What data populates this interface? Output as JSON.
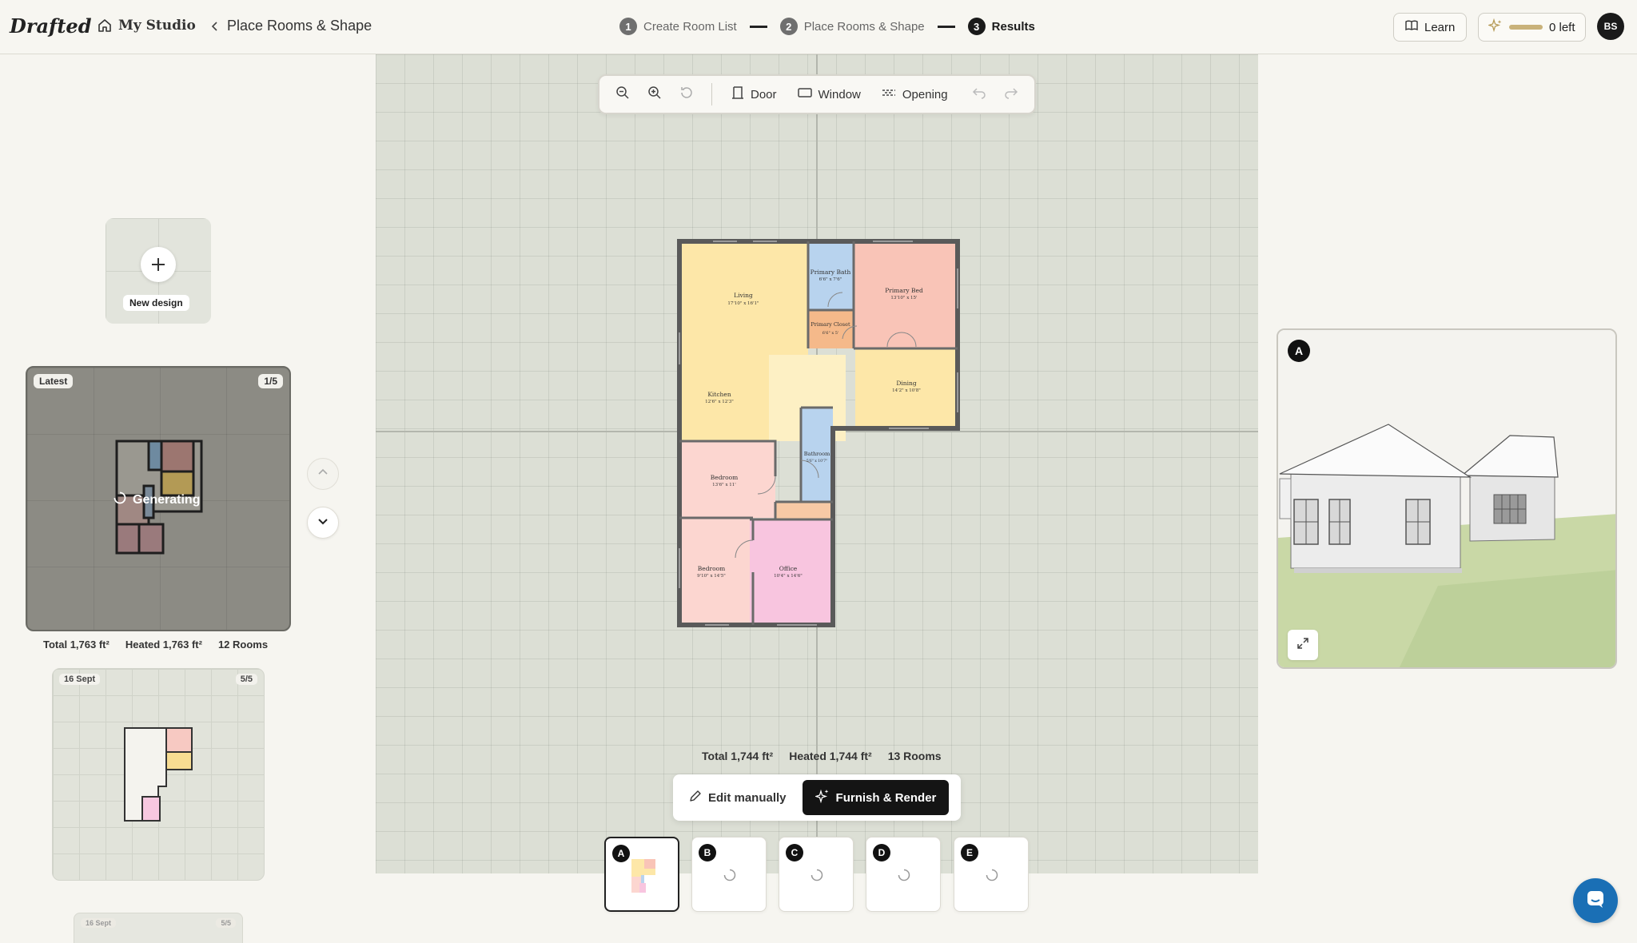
{
  "app": {
    "logo": "Drafted"
  },
  "breadcrumb": {
    "studio": "My Studio",
    "current": "Place Rooms & Shape"
  },
  "steps": [
    {
      "num": "1",
      "label": "Create Room List"
    },
    {
      "num": "2",
      "label": "Place Rooms & Shape"
    },
    {
      "num": "3",
      "label": "Results"
    }
  ],
  "header": {
    "learn_label": "Learn",
    "credits_label": "0 left",
    "avatar_initials": "BS"
  },
  "sidebar": {
    "new_design_label": "New design",
    "latest": {
      "tag": "Latest",
      "count": "1/5",
      "status": "Generating",
      "stats": {
        "total": "Total 1,763 ft²",
        "heated": "Heated 1,763 ft²",
        "rooms": "12 Rooms"
      }
    },
    "history": [
      {
        "date": "16 Sept",
        "count": "5/5"
      },
      {
        "date": "16 Sept",
        "count": "5/5"
      }
    ]
  },
  "toolbar": {
    "door": "Door",
    "window": "Window",
    "opening": "Opening"
  },
  "plan": {
    "rooms": [
      {
        "name": "Living",
        "dims": "17'10\" x 16'1\""
      },
      {
        "name": "Primary Bath",
        "dims": "6'6\" x 7'6\""
      },
      {
        "name": "Primary Bed",
        "dims": "13'10\" x 15'"
      },
      {
        "name": "Primary Closet",
        "dims": "6'6\" x 5'"
      },
      {
        "name": "Kitchen",
        "dims": "12'6\" x 12'3\""
      },
      {
        "name": "Dining",
        "dims": "14'2\" x 10'8\""
      },
      {
        "name": "Bathroom",
        "dims": "5'6\" x 10'7\""
      },
      {
        "name": "Bedroom",
        "dims": "13'6\" x 11'"
      },
      {
        "name": "Bedroom",
        "dims": "9'10\" x 14'5\""
      },
      {
        "name": "Office",
        "dims": "10'4\" x 14'6\""
      }
    ],
    "stats": {
      "total": "Total 1,744 ft²",
      "heated": "Heated 1,744 ft²",
      "rooms": "13 Rooms"
    }
  },
  "actions": {
    "edit": "Edit manually",
    "furnish": "Furnish & Render"
  },
  "variants": [
    "A",
    "B",
    "C",
    "D",
    "E"
  ],
  "render": {
    "label": "A"
  },
  "colors": {
    "accent": "#141414",
    "living": "#fde7a8",
    "bath": "#b8d3ee",
    "bedroom": "#f9c4b7",
    "office": "#f8c5df",
    "closet": "#f5b98a",
    "chat": "#1a6fb5"
  }
}
